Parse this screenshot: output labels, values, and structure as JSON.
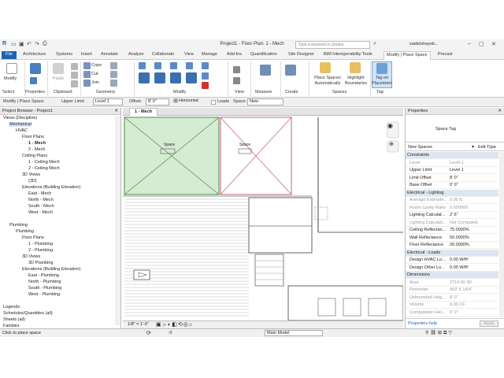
{
  "app": {
    "title": "Project1 - Floor Plan: 1 - Mech",
    "search_placeholder": "Type a keyword or phrase",
    "user": "saidelshayeb..."
  },
  "ribbon_tabs": [
    "File",
    "Architecture",
    "Systems",
    "Insert",
    "Annotate",
    "Analyze",
    "Collaborate",
    "View",
    "Manage",
    "Add-Ins",
    "Quantification",
    "Site Designer",
    "BIM Interoperability Tools",
    "Modify | Place Space",
    "Precast"
  ],
  "ribbon": {
    "modify": "Modify",
    "paste": "Paste",
    "cope": "Cope",
    "cut": "Cut",
    "join": "Join",
    "place_spaces": "Place Spaces Automatically",
    "highlight": "Highlight Boundaries",
    "tag_on_placement": "Tag on Placement",
    "panels": {
      "select": "Select",
      "properties": "Properties",
      "clipboard": "Clipboard",
      "geometry": "Geometry",
      "modify": "Modify",
      "view": "View",
      "measure": "Measure",
      "create": "Create",
      "spaces": "Spaces",
      "tag": "Tag"
    }
  },
  "options_bar": {
    "context": "Modify | Place Space",
    "upper_limit_label": "Upper Limit:",
    "upper_limit": "Level 1",
    "offset_label": "Offset:",
    "offset": "8' 0\"",
    "orientation": "Horizontal",
    "leader": "Leade",
    "space_label": "Space:",
    "space": "New"
  },
  "project_browser": {
    "title": "Project Browser - Project1",
    "items": [
      {
        "label": "Views (Discipline)",
        "indent": 0,
        "bold": false,
        "sel": false
      },
      {
        "label": "Mechanical",
        "indent": 1,
        "bold": false,
        "sel": true
      },
      {
        "label": "HVAC",
        "indent": 2,
        "bold": false,
        "sel": false
      },
      {
        "label": "Floor Plans",
        "indent": 3,
        "bold": false,
        "sel": false
      },
      {
        "label": "1 - Mech",
        "indent": 4,
        "bold": true,
        "sel": false
      },
      {
        "label": "2 - Mech",
        "indent": 4,
        "bold": false,
        "sel": false
      },
      {
        "label": "Ceiling Plans",
        "indent": 3,
        "bold": false,
        "sel": false
      },
      {
        "label": "1 - Ceiling Mech",
        "indent": 4,
        "bold": false,
        "sel": false
      },
      {
        "label": "2 - Ceiling Mech",
        "indent": 4,
        "bold": false,
        "sel": false
      },
      {
        "label": "3D Views",
        "indent": 3,
        "bold": false,
        "sel": false
      },
      {
        "label": "{3D}",
        "indent": 4,
        "bold": false,
        "sel": false
      },
      {
        "label": "Elevations (Building Elevation)",
        "indent": 3,
        "bold": false,
        "sel": false
      },
      {
        "label": "East - Mech",
        "indent": 4,
        "bold": false,
        "sel": false
      },
      {
        "label": "North - Mech",
        "indent": 4,
        "bold": false,
        "sel": false
      },
      {
        "label": "South - Mech",
        "indent": 4,
        "bold": false,
        "sel": false
      },
      {
        "label": "West - Mech",
        "indent": 4,
        "bold": false,
        "sel": false
      },
      {
        "label": "",
        "indent": 0,
        "bold": false,
        "sel": false
      },
      {
        "label": "Plumbing",
        "indent": 1,
        "bold": false,
        "sel": false
      },
      {
        "label": "Plumbing",
        "indent": 2,
        "bold": false,
        "sel": false
      },
      {
        "label": "Floor Plans",
        "indent": 3,
        "bold": false,
        "sel": false
      },
      {
        "label": "1 - Plumbing",
        "indent": 4,
        "bold": false,
        "sel": false
      },
      {
        "label": "2 - Plumbing",
        "indent": 4,
        "bold": false,
        "sel": false
      },
      {
        "label": "3D Views",
        "indent": 3,
        "bold": false,
        "sel": false
      },
      {
        "label": "3D Plumbing",
        "indent": 4,
        "bold": false,
        "sel": false
      },
      {
        "label": "Elevations (Building Elevation)",
        "indent": 3,
        "bold": false,
        "sel": false
      },
      {
        "label": "East - Plumbing",
        "indent": 4,
        "bold": false,
        "sel": false
      },
      {
        "label": "North - Plumbing",
        "indent": 4,
        "bold": false,
        "sel": false
      },
      {
        "label": "South - Plumbing",
        "indent": 4,
        "bold": false,
        "sel": false
      },
      {
        "label": "West - Plumbing",
        "indent": 4,
        "bold": false,
        "sel": false
      },
      {
        "label": "",
        "indent": 0,
        "bold": false,
        "sel": false
      },
      {
        "label": "Legends",
        "indent": 0,
        "bold": false,
        "sel": false
      },
      {
        "label": "Schedules/Quantities (all)",
        "indent": 0,
        "bold": false,
        "sel": false
      },
      {
        "label": "Sheets (all)",
        "indent": 0,
        "bold": false,
        "sel": false
      },
      {
        "label": "Families",
        "indent": 0,
        "bold": false,
        "sel": false
      }
    ]
  },
  "view": {
    "tab": "1 - Mech",
    "scale": "1/8\" = 1'-0\"",
    "space_tag_1": "Space",
    "space_tag_2": "Space"
  },
  "properties": {
    "title": "Properties",
    "type_name": "Space Tag",
    "selector": "New Spaces",
    "edit_type": "Edit Type",
    "help": "Properties help",
    "apply": "Apply",
    "rows": [
      {
        "k": "Constraints",
        "v": "",
        "hd": true,
        "dim": false
      },
      {
        "k": "Level",
        "v": "Level 1",
        "hd": false,
        "dim": true
      },
      {
        "k": "Upper Limit",
        "v": "Level 1",
        "hd": false,
        "dim": false
      },
      {
        "k": "Limit Offset",
        "v": "8' 0\"",
        "hd": false,
        "dim": false
      },
      {
        "k": "Base Offset",
        "v": "0' 0\"",
        "hd": false,
        "dim": false
      },
      {
        "k": "Electrical - Lighting",
        "v": "",
        "hd": true,
        "dim": false
      },
      {
        "k": "Average Estimate...",
        "v": "0.00 fc",
        "hd": false,
        "dim": true
      },
      {
        "k": "Room Cavity Ratio",
        "v": "0.000000",
        "hd": false,
        "dim": true
      },
      {
        "k": "Lighting Calculat...",
        "v": "2' 6\"",
        "hd": false,
        "dim": false
      },
      {
        "k": "Lighting Calculati...",
        "v": "Not Computed",
        "hd": false,
        "dim": true
      },
      {
        "k": "Ceiling Reflectan...",
        "v": "75.0000%",
        "hd": false,
        "dim": false
      },
      {
        "k": "Wall Reflectance",
        "v": "50.0000%",
        "hd": false,
        "dim": false
      },
      {
        "k": "Floor Reflectance",
        "v": "20.0000%",
        "hd": false,
        "dim": false
      },
      {
        "k": "Electrical - Loads",
        "v": "",
        "hd": true,
        "dim": false
      },
      {
        "k": "Design HVAC Lo...",
        "v": "0.00 W/ft²",
        "hd": false,
        "dim": false
      },
      {
        "k": "Design Other Lo...",
        "v": "0.00 W/ft²",
        "hd": false,
        "dim": false
      },
      {
        "k": "Dimensions",
        "v": "",
        "hd": true,
        "dim": false
      },
      {
        "k": "Area",
        "v": "2714.00 SF",
        "hd": false,
        "dim": true
      },
      {
        "k": "Perimeter",
        "v": "403' 5 1/64\"",
        "hd": false,
        "dim": true
      },
      {
        "k": "Unbounded Heig...",
        "v": "8' 0\"",
        "hd": false,
        "dim": true
      },
      {
        "k": "Volume",
        "v": "0.00 CF",
        "hd": false,
        "dim": true
      },
      {
        "k": "Computation Hei...",
        "v": "0' 0\"",
        "hd": false,
        "dim": true
      }
    ]
  },
  "status": {
    "message": "Click to place space",
    "model": "Main Model",
    "zero": ":0"
  }
}
